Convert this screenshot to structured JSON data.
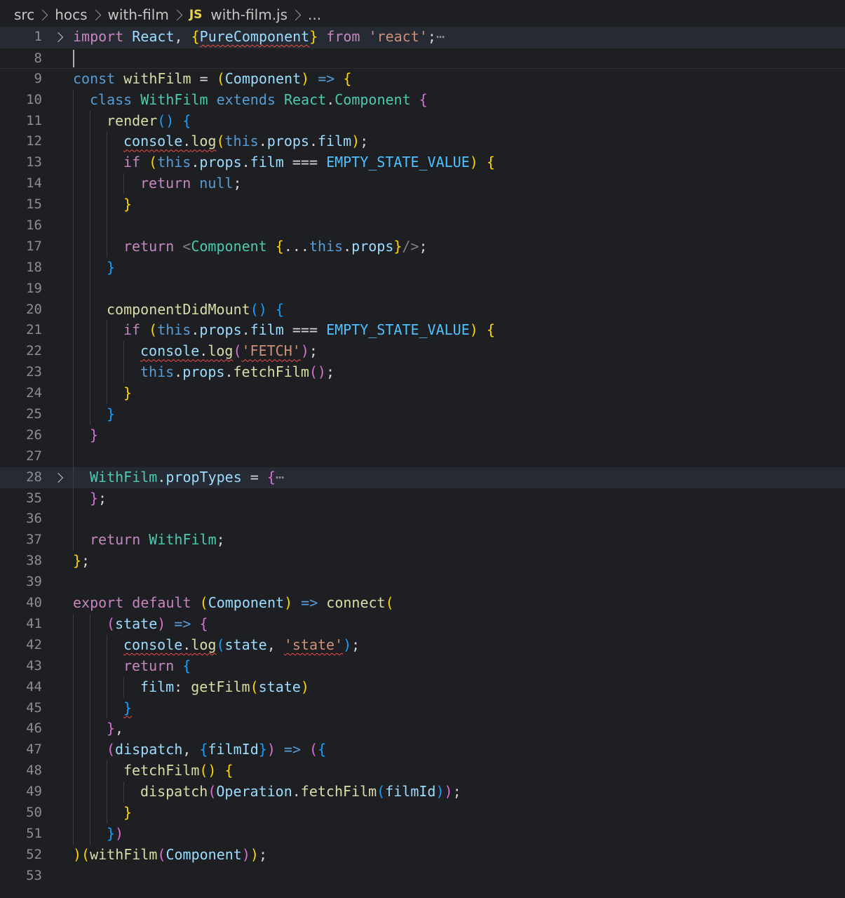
{
  "breadcrumb": {
    "items": [
      "src",
      "hocs",
      "with-film"
    ],
    "file_badge": "JS",
    "file_name": "with-film.js",
    "trailing": "..."
  },
  "lines": [
    {
      "n": "1",
      "fold": true,
      "highlight": true,
      "indent": 0,
      "tokens": [
        {
          "t": "import",
          "c": "k"
        },
        {
          "t": " "
        },
        {
          "t": "React",
          "c": "v"
        },
        {
          "t": ", "
        },
        {
          "t": "{",
          "c": "b1"
        },
        {
          "t": "PureComponent",
          "c": "v",
          "sq": true
        },
        {
          "t": "}",
          "c": "b1"
        },
        {
          "t": " "
        },
        {
          "t": "from",
          "c": "k"
        },
        {
          "t": " "
        },
        {
          "t": "'react'",
          "c": "s"
        },
        {
          "t": ";"
        },
        {
          "t": "⋯",
          "c": "dots"
        }
      ]
    },
    {
      "n": "8",
      "current": true,
      "cursor": true,
      "indent": 0,
      "tokens": []
    },
    {
      "n": "9",
      "indent": 0,
      "tokens": [
        {
          "t": "const",
          "c": "kw"
        },
        {
          "t": " "
        },
        {
          "t": "withFilm",
          "c": "f"
        },
        {
          "t": " = "
        },
        {
          "t": "(",
          "c": "b1"
        },
        {
          "t": "Component",
          "c": "v"
        },
        {
          "t": ")",
          "c": "b1"
        },
        {
          "t": " "
        },
        {
          "t": "=>",
          "c": "kw"
        },
        {
          "t": " "
        },
        {
          "t": "{",
          "c": "b1"
        }
      ]
    },
    {
      "n": "10",
      "indent": 1,
      "tokens": [
        {
          "t": "class",
          "c": "kw"
        },
        {
          "t": " "
        },
        {
          "t": "WithFilm",
          "c": "cls"
        },
        {
          "t": " "
        },
        {
          "t": "extends",
          "c": "kw"
        },
        {
          "t": " "
        },
        {
          "t": "React",
          "c": "cls"
        },
        {
          "t": "."
        },
        {
          "t": "Component",
          "c": "cls"
        },
        {
          "t": " "
        },
        {
          "t": "{",
          "c": "b2"
        }
      ]
    },
    {
      "n": "11",
      "indent": 2,
      "tokens": [
        {
          "t": "render",
          "c": "f"
        },
        {
          "t": "()",
          "c": "b3"
        },
        {
          "t": " "
        },
        {
          "t": "{",
          "c": "b3"
        }
      ]
    },
    {
      "n": "12",
      "indent": 3,
      "tokens": [
        {
          "t": "console",
          "c": "v",
          "sq": true
        },
        {
          "t": ".",
          "sq": true
        },
        {
          "t": "log",
          "c": "f",
          "sq": true
        },
        {
          "t": "(",
          "c": "b1"
        },
        {
          "t": "this",
          "c": "kw"
        },
        {
          "t": "."
        },
        {
          "t": "props",
          "c": "v"
        },
        {
          "t": "."
        },
        {
          "t": "film",
          "c": "v"
        },
        {
          "t": ")",
          "c": "b1"
        },
        {
          "t": ";"
        }
      ]
    },
    {
      "n": "13",
      "indent": 3,
      "tokens": [
        {
          "t": "if",
          "c": "k"
        },
        {
          "t": " "
        },
        {
          "t": "(",
          "c": "b1"
        },
        {
          "t": "this",
          "c": "kw"
        },
        {
          "t": "."
        },
        {
          "t": "props",
          "c": "v"
        },
        {
          "t": "."
        },
        {
          "t": "film",
          "c": "v"
        },
        {
          "t": " === "
        },
        {
          "t": "EMPTY_STATE_VALUE",
          "c": "c"
        },
        {
          "t": ")",
          "c": "b1"
        },
        {
          "t": " "
        },
        {
          "t": "{",
          "c": "b1"
        }
      ]
    },
    {
      "n": "14",
      "indent": 4,
      "tokens": [
        {
          "t": "return",
          "c": "k"
        },
        {
          "t": " "
        },
        {
          "t": "null",
          "c": "kw"
        },
        {
          "t": ";"
        }
      ]
    },
    {
      "n": "15",
      "indent": 3,
      "tokens": [
        {
          "t": "}",
          "c": "b1"
        }
      ]
    },
    {
      "n": "16",
      "indent": 3,
      "tokens": []
    },
    {
      "n": "17",
      "indent": 3,
      "tokens": [
        {
          "t": "return",
          "c": "k"
        },
        {
          "t": " "
        },
        {
          "t": "<",
          "c": "tag"
        },
        {
          "t": "Component",
          "c": "cls"
        },
        {
          "t": " "
        },
        {
          "t": "{",
          "c": "b1"
        },
        {
          "t": "..."
        },
        {
          "t": "this",
          "c": "kw"
        },
        {
          "t": "."
        },
        {
          "t": "props",
          "c": "v"
        },
        {
          "t": "}",
          "c": "b1"
        },
        {
          "t": "/>",
          "c": "tag"
        },
        {
          "t": ";"
        }
      ]
    },
    {
      "n": "18",
      "indent": 2,
      "tokens": [
        {
          "t": "}",
          "c": "b3"
        }
      ]
    },
    {
      "n": "19",
      "indent": 2,
      "tokens": []
    },
    {
      "n": "20",
      "indent": 2,
      "tokens": [
        {
          "t": "componentDidMount",
          "c": "f"
        },
        {
          "t": "()",
          "c": "b3"
        },
        {
          "t": " "
        },
        {
          "t": "{",
          "c": "b3"
        }
      ]
    },
    {
      "n": "21",
      "indent": 3,
      "tokens": [
        {
          "t": "if",
          "c": "k"
        },
        {
          "t": " "
        },
        {
          "t": "(",
          "c": "b1"
        },
        {
          "t": "this",
          "c": "kw"
        },
        {
          "t": "."
        },
        {
          "t": "props",
          "c": "v"
        },
        {
          "t": "."
        },
        {
          "t": "film",
          "c": "v"
        },
        {
          "t": " === "
        },
        {
          "t": "EMPTY_STATE_VALUE",
          "c": "c"
        },
        {
          "t": ")",
          "c": "b1"
        },
        {
          "t": " "
        },
        {
          "t": "{",
          "c": "b1"
        }
      ]
    },
    {
      "n": "22",
      "indent": 4,
      "tokens": [
        {
          "t": "console",
          "c": "v",
          "sq": true
        },
        {
          "t": ".",
          "sq": true
        },
        {
          "t": "log",
          "c": "f",
          "sq": true
        },
        {
          "t": "(",
          "c": "b2"
        },
        {
          "t": "'FETCH'",
          "c": "s",
          "sq": true
        },
        {
          "t": ")",
          "c": "b2"
        },
        {
          "t": ";"
        }
      ]
    },
    {
      "n": "23",
      "indent": 4,
      "tokens": [
        {
          "t": "this",
          "c": "kw"
        },
        {
          "t": "."
        },
        {
          "t": "props",
          "c": "v"
        },
        {
          "t": "."
        },
        {
          "t": "fetchFilm",
          "c": "f"
        },
        {
          "t": "()",
          "c": "b2"
        },
        {
          "t": ";"
        }
      ]
    },
    {
      "n": "24",
      "indent": 3,
      "tokens": [
        {
          "t": "}",
          "c": "b1"
        }
      ]
    },
    {
      "n": "25",
      "indent": 2,
      "tokens": [
        {
          "t": "}",
          "c": "b3"
        }
      ]
    },
    {
      "n": "26",
      "indent": 1,
      "tokens": [
        {
          "t": "}",
          "c": "b2"
        }
      ]
    },
    {
      "n": "27",
      "indent": 1,
      "tokens": []
    },
    {
      "n": "28",
      "fold": true,
      "highlight": true,
      "indent": 1,
      "tokens": [
        {
          "t": "WithFilm",
          "c": "cls"
        },
        {
          "t": "."
        },
        {
          "t": "propTypes",
          "c": "v"
        },
        {
          "t": " = "
        },
        {
          "t": "{",
          "c": "b2"
        },
        {
          "t": "⋯",
          "c": "dots"
        }
      ]
    },
    {
      "n": "35",
      "indent": 1,
      "tokens": [
        {
          "t": "}",
          "c": "b2"
        },
        {
          "t": ";"
        }
      ]
    },
    {
      "n": "36",
      "indent": 1,
      "tokens": []
    },
    {
      "n": "37",
      "indent": 1,
      "tokens": [
        {
          "t": "return",
          "c": "k"
        },
        {
          "t": " "
        },
        {
          "t": "WithFilm",
          "c": "cls"
        },
        {
          "t": ";"
        }
      ]
    },
    {
      "n": "38",
      "indent": 0,
      "tokens": [
        {
          "t": "}",
          "c": "b1"
        },
        {
          "t": ";"
        }
      ]
    },
    {
      "n": "39",
      "indent": 0,
      "tokens": []
    },
    {
      "n": "40",
      "indent": 0,
      "tokens": [
        {
          "t": "export",
          "c": "k"
        },
        {
          "t": " "
        },
        {
          "t": "default",
          "c": "k"
        },
        {
          "t": " "
        },
        {
          "t": "(",
          "c": "b1"
        },
        {
          "t": "Component",
          "c": "v"
        },
        {
          "t": ")",
          "c": "b1"
        },
        {
          "t": " "
        },
        {
          "t": "=>",
          "c": "kw"
        },
        {
          "t": " "
        },
        {
          "t": "connect",
          "c": "f"
        },
        {
          "t": "(",
          "c": "b1"
        }
      ]
    },
    {
      "n": "41",
      "indent": 2,
      "tokens": [
        {
          "t": "(",
          "c": "b2"
        },
        {
          "t": "state",
          "c": "v"
        },
        {
          "t": ")",
          "c": "b2"
        },
        {
          "t": " "
        },
        {
          "t": "=>",
          "c": "kw"
        },
        {
          "t": " "
        },
        {
          "t": "{",
          "c": "b2"
        }
      ]
    },
    {
      "n": "42",
      "indent": 3,
      "tokens": [
        {
          "t": "console",
          "c": "v",
          "sq": true
        },
        {
          "t": ".",
          "sq": true
        },
        {
          "t": "log",
          "c": "f",
          "sq": true
        },
        {
          "t": "(",
          "c": "b3"
        },
        {
          "t": "state",
          "c": "v"
        },
        {
          "t": ", "
        },
        {
          "t": "'state'",
          "c": "s",
          "sq": true
        },
        {
          "t": ")",
          "c": "b3"
        },
        {
          "t": ";"
        }
      ]
    },
    {
      "n": "43",
      "indent": 3,
      "tokens": [
        {
          "t": "return",
          "c": "k"
        },
        {
          "t": " "
        },
        {
          "t": "{",
          "c": "b3"
        }
      ]
    },
    {
      "n": "44",
      "indent": 4,
      "tokens": [
        {
          "t": "film",
          "c": "v"
        },
        {
          "t": ": "
        },
        {
          "t": "getFilm",
          "c": "f"
        },
        {
          "t": "(",
          "c": "b1"
        },
        {
          "t": "state",
          "c": "v"
        },
        {
          "t": ")",
          "c": "b1"
        }
      ]
    },
    {
      "n": "45",
      "indent": 3,
      "tokens": [
        {
          "t": "}",
          "c": "b3",
          "sq": true
        }
      ]
    },
    {
      "n": "46",
      "indent": 2,
      "tokens": [
        {
          "t": "}",
          "c": "b2"
        },
        {
          "t": ","
        }
      ]
    },
    {
      "n": "47",
      "indent": 2,
      "tokens": [
        {
          "t": "(",
          "c": "b2"
        },
        {
          "t": "dispatch",
          "c": "v"
        },
        {
          "t": ", "
        },
        {
          "t": "{",
          "c": "b3"
        },
        {
          "t": "filmId",
          "c": "v"
        },
        {
          "t": "}",
          "c": "b3"
        },
        {
          "t": ")",
          "c": "b2"
        },
        {
          "t": " "
        },
        {
          "t": "=>",
          "c": "kw"
        },
        {
          "t": " "
        },
        {
          "t": "(",
          "c": "b2"
        },
        {
          "t": "{",
          "c": "b3"
        }
      ]
    },
    {
      "n": "48",
      "indent": 3,
      "tokens": [
        {
          "t": "fetchFilm",
          "c": "f"
        },
        {
          "t": "()",
          "c": "b1"
        },
        {
          "t": " "
        },
        {
          "t": "{",
          "c": "b1"
        }
      ]
    },
    {
      "n": "49",
      "indent": 4,
      "tokens": [
        {
          "t": "dispatch",
          "c": "f"
        },
        {
          "t": "(",
          "c": "b2"
        },
        {
          "t": "Operation",
          "c": "v"
        },
        {
          "t": "."
        },
        {
          "t": "fetchFilm",
          "c": "f"
        },
        {
          "t": "(",
          "c": "b3"
        },
        {
          "t": "filmId",
          "c": "v"
        },
        {
          "t": ")",
          "c": "b3"
        },
        {
          "t": ")",
          "c": "b2"
        },
        {
          "t": ";"
        }
      ]
    },
    {
      "n": "50",
      "indent": 3,
      "tokens": [
        {
          "t": "}",
          "c": "b1"
        }
      ]
    },
    {
      "n": "51",
      "indent": 2,
      "tokens": [
        {
          "t": "}",
          "c": "b3"
        },
        {
          "t": ")",
          "c": "b2"
        }
      ]
    },
    {
      "n": "52",
      "indent": 0,
      "tokens": [
        {
          "t": ")",
          "c": "b1"
        },
        {
          "t": "(",
          "c": "b1"
        },
        {
          "t": "withFilm",
          "c": "f"
        },
        {
          "t": "(",
          "c": "b2"
        },
        {
          "t": "Component",
          "c": "v"
        },
        {
          "t": ")",
          "c": "b2"
        },
        {
          "t": ")",
          "c": "b1"
        },
        {
          "t": ";"
        }
      ]
    },
    {
      "n": "53",
      "indent": 0,
      "tokens": []
    }
  ]
}
